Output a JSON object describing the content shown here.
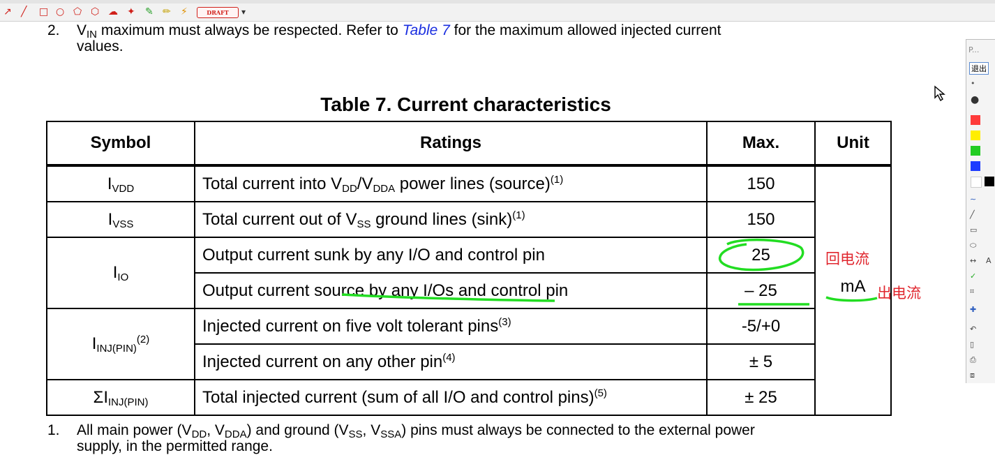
{
  "toolbar": {
    "draft_label": "DRAFT",
    "tools": [
      "arrow-icon",
      "line-icon",
      "rectangle-icon",
      "ellipse-icon",
      "polygon-icon",
      "pentagon-icon",
      "cloud-icon",
      "pin-icon",
      "highlighter-icon",
      "pencil-icon",
      "eraser-icon"
    ]
  },
  "note2": {
    "number": "2.",
    "pre": "V",
    "sub": "IN",
    "mid": " maximum must always be respected. Refer to ",
    "link": "Table 7",
    "post": " for the maximum allowed injected current",
    "line2": "values."
  },
  "table": {
    "title": "Table 7. Current characteristics",
    "headers": {
      "symbol": "Symbol",
      "ratings": "Ratings",
      "max": "Max.",
      "unit": "Unit"
    },
    "unit": "mA",
    "rows": [
      {
        "sym_main": "I",
        "sym_sub": "VDD",
        "r1": "Total current into V",
        "r1_sub": "DD",
        "r2": "/V",
        "r2_sub": "DDA",
        "r3": " power lines (source)",
        "sup": "(1)",
        "max": "150"
      },
      {
        "sym_main": "I",
        "sym_sub": "VSS",
        "r1": "Total current out of V",
        "r1_sub": "SS",
        "r3": " ground lines (sink)",
        "sup": "(1)",
        "max": "150"
      },
      {
        "sym_main": "I",
        "sym_sub": "IO",
        "rating": "Output current sunk by any I/O and control pin",
        "max": "25"
      },
      {
        "rating": "Output current source by any I/Os and control pin",
        "max": "– 25"
      },
      {
        "sym_main": "I",
        "sym_sub": "INJ(PIN)",
        "sym_sup": "(2)",
        "rating": "Injected current on five volt tolerant pins",
        "sup": "(3)",
        "max": "-5/+0"
      },
      {
        "rating": "Injected current on any other pin",
        "sup": "(4)",
        "max": "± 5"
      },
      {
        "sym_main": "ΣI",
        "sym_sub": "INJ(PIN)",
        "rating": "Total injected current (sum of all I/O and control pins)",
        "sup": "(5)",
        "max": "± 25"
      }
    ]
  },
  "annotations": {
    "sink_label": "回电流",
    "source_label": "出电流"
  },
  "note1": {
    "number": "1.",
    "a": "All main power (V",
    "a_sub": "DD",
    "b": ", V",
    "b_sub": "DDA",
    "c": ") and ground (V",
    "c_sub": "SS",
    "d": ", V",
    "d_sub": "SSA",
    "e": ") pins must always be connected to the external power",
    "line2": "supply, in the permitted range."
  },
  "side_panel": {
    "search_text": "P...",
    "exit_label": "退出",
    "text_tool": "A",
    "colors": [
      "#ff3b3b",
      "#ffee00",
      "#22cc22",
      "#1e3cff",
      "#ffffff",
      "#000000"
    ]
  }
}
